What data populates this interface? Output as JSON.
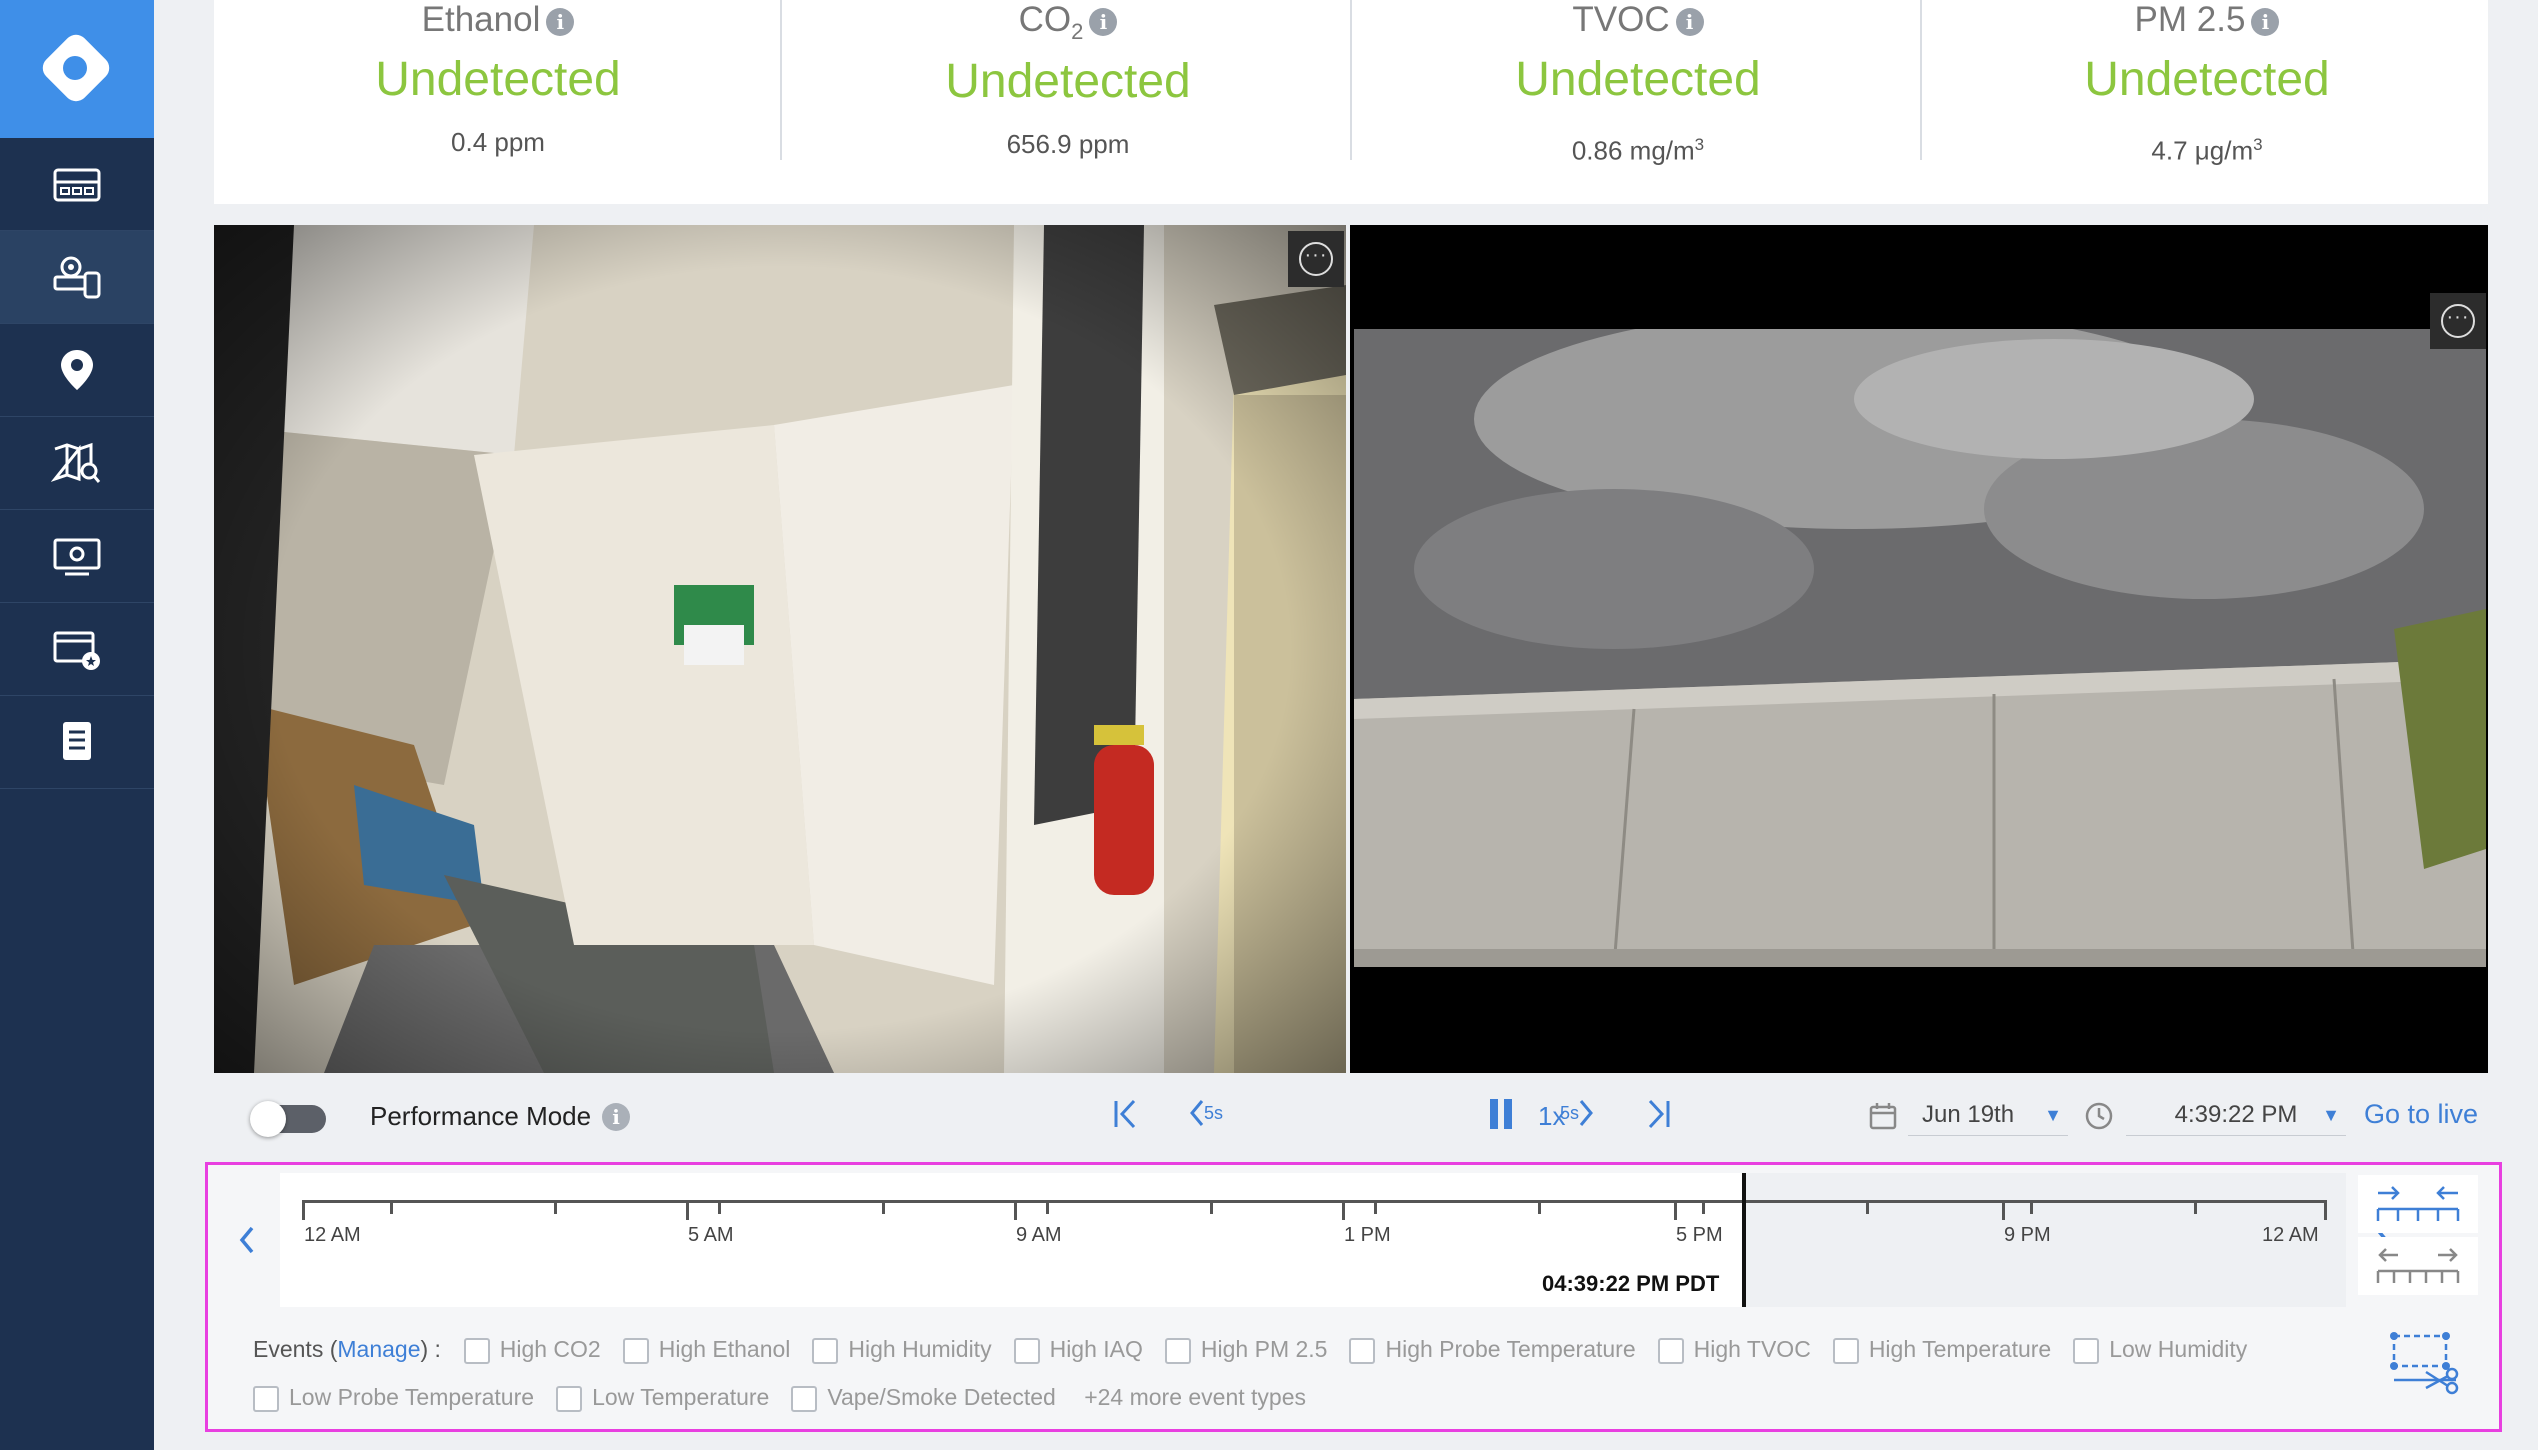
{
  "sidebar": {
    "logo": "diamond-logo-icon",
    "items": [
      {
        "icon": "dashboard-icon"
      },
      {
        "icon": "devices-icon",
        "active": true
      },
      {
        "icon": "location-pin-icon"
      },
      {
        "icon": "map-search-icon"
      },
      {
        "icon": "monitor-icon"
      },
      {
        "icon": "video-library-icon"
      },
      {
        "icon": "document-icon"
      }
    ]
  },
  "sensors": [
    {
      "name": "Ethanol",
      "status": "Undetected",
      "value": "0.4 ppm"
    },
    {
      "name_main": "CO",
      "name_sub": "2",
      "status": "Undetected",
      "value": "656.9 ppm"
    },
    {
      "name": "TVOC",
      "status": "Undetected",
      "value_main": "0.86 mg/m",
      "value_sup": "3"
    },
    {
      "name": "PM 2.5",
      "status": "Undetected",
      "value_main": "4.7 μg/m",
      "value_sup": "3"
    }
  ],
  "info_glyph": "i",
  "controls": {
    "performance_mode_label": "Performance Mode",
    "performance_mode_on": false,
    "skip_back_label": "5s",
    "skip_forward_label": "5s",
    "speed": "1x",
    "date": "Jun 19th",
    "time": "4:39:22 PM",
    "go_live": "Go to live"
  },
  "timeline": {
    "tick_labels": [
      "12 AM",
      "5 AM",
      "9 AM",
      "1 PM",
      "5 PM",
      "9 PM",
      "12 AM"
    ],
    "playhead_time": "04:39:22 PM PDT"
  },
  "events": {
    "label": "Events (",
    "manage": "Manage",
    "label_end": ") :",
    "types": [
      "High CO2",
      "High Ethanol",
      "High Humidity",
      "High IAQ",
      "High PM 2.5",
      "High Probe Temperature",
      "High TVOC",
      "High Temperature",
      "Low Humidity",
      "Low Probe Temperature",
      "Low Temperature",
      "Vape/Smoke Detected"
    ],
    "more": "+24 more event types"
  },
  "colors": {
    "sidebar": "#1d3150",
    "accent": "#3e7fd6",
    "status_ok": "#8cc63f",
    "highlight_border": "#e83fe0"
  }
}
